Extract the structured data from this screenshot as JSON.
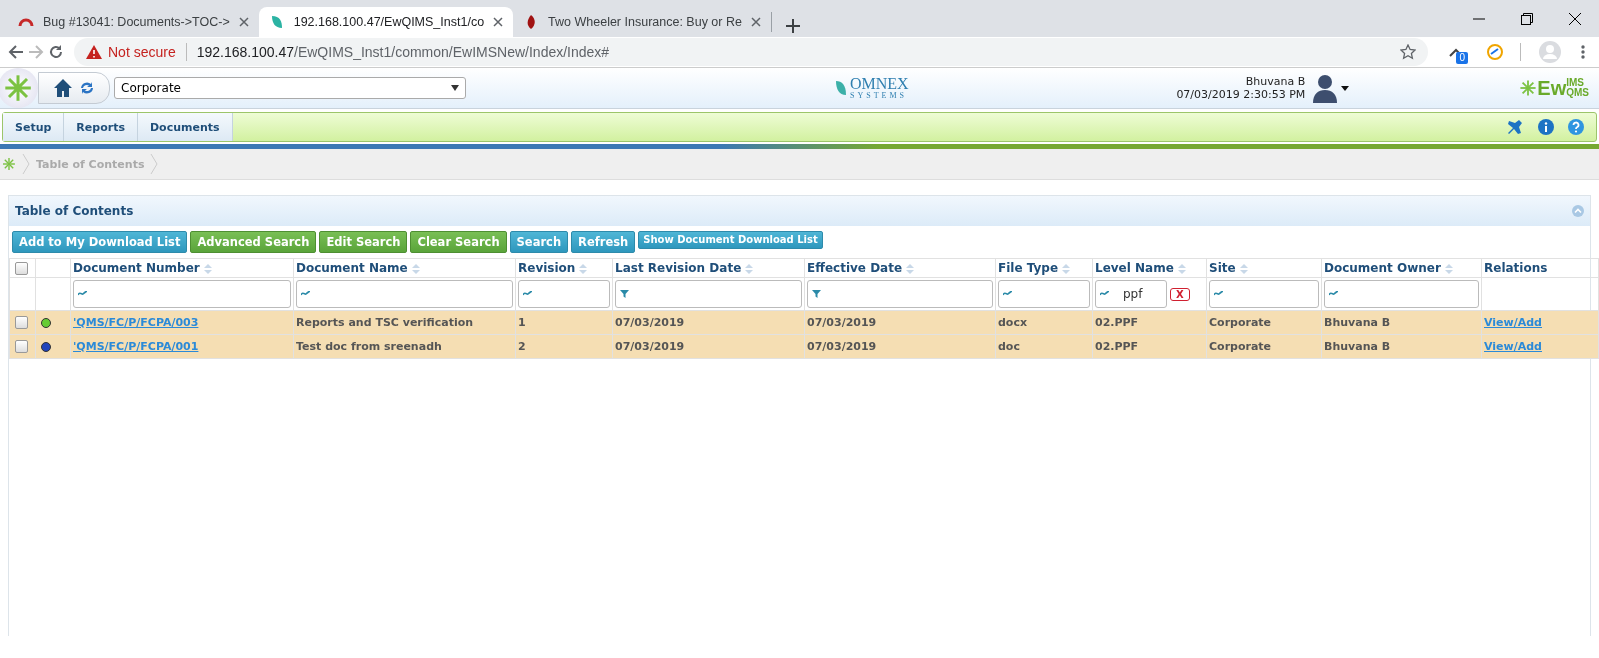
{
  "browser": {
    "tabs": [
      {
        "title": "Bug #13041: Documents->TOC->",
        "selected": false
      },
      {
        "title": "192.168.100.47/EwQIMS_Inst1/co",
        "selected": true
      },
      {
        "title": "Two Wheeler Insurance: Buy or Re",
        "selected": false
      }
    ],
    "address": {
      "warning": "Not secure",
      "host": "192.168.100.47",
      "path": "/EwQIMS_Inst1/common/EwIMSNew/Index/Index#"
    },
    "extension_badge": "0"
  },
  "header": {
    "site": "Corporate",
    "company_logo": {
      "name": "OMNEX",
      "tagline": "SYSTEMS"
    },
    "user": "Bhuvana B",
    "datetime": "07/03/2019 2:30:53 PM",
    "product_logo": {
      "main": "Ew",
      "top": "IMS",
      "bottom": "QMS"
    }
  },
  "menu": [
    "Setup",
    "Reports",
    "Documents"
  ],
  "breadcrumb": [
    "Table of Contents"
  ],
  "panel": {
    "title": "Table of Contents",
    "buttons": [
      {
        "label": "Add to My Download List",
        "kind": "blue"
      },
      {
        "label": "Advanced Search",
        "kind": "green"
      },
      {
        "label": "Edit Search",
        "kind": "green"
      },
      {
        "label": "Clear Search",
        "kind": "green"
      },
      {
        "label": "Search",
        "kind": "blue"
      },
      {
        "label": "Refresh",
        "kind": "blue"
      },
      {
        "label": "Show Document Download List",
        "kind": "small"
      }
    ],
    "table": {
      "select_all": {
        "checked": false
      },
      "columns": [
        {
          "label": "Document Number",
          "sortable": true,
          "kind": "text"
        },
        {
          "label": "Document Name",
          "sortable": true,
          "kind": "text"
        },
        {
          "label": "Revision",
          "sortable": true,
          "kind": "text"
        },
        {
          "label": "Last Revision Date",
          "sortable": true,
          "kind": "date"
        },
        {
          "label": "Effective Date",
          "sortable": true,
          "kind": "date"
        },
        {
          "label": "File Type",
          "sortable": true,
          "kind": "text"
        },
        {
          "label": "Level Name",
          "sortable": true,
          "kind": "text",
          "filter_value": "ppf",
          "clear_label": "X"
        },
        {
          "label": "Site",
          "sortable": true,
          "kind": "text"
        },
        {
          "label": "Document Owner",
          "sortable": true,
          "kind": "text"
        },
        {
          "label": "Relations",
          "sortable": false,
          "kind": "none"
        }
      ],
      "rows": [
        {
          "checked": false,
          "color": "#66cc33",
          "cells": [
            "'QMS/FC/P/FCPA/003",
            "Reports and TSC verification",
            "1",
            "07/03/2019",
            "07/03/2019",
            "docx",
            "02.PPF",
            "Corporate",
            "Bhuvana B",
            "View/Add"
          ]
        },
        {
          "checked": false,
          "color": "#2244bb",
          "cells": [
            "'QMS/FC/P/FCPA/001",
            "Test doc from sreenadh",
            "2",
            "07/03/2019",
            "07/03/2019",
            "doc",
            "02.PPF",
            "Corporate",
            "Bhuvana B",
            "View/Add"
          ]
        }
      ]
    }
  }
}
